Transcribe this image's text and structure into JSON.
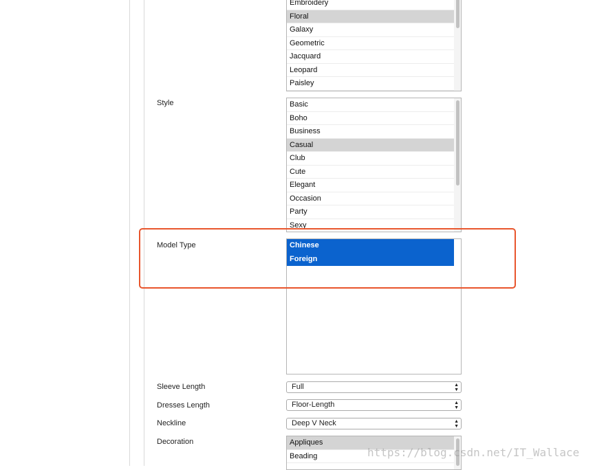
{
  "pattern": {
    "items": [
      "Embroidery",
      "Floral",
      "Galaxy",
      "Geometric",
      "Jacquard",
      "Leopard",
      "Paisley"
    ]
  },
  "style": {
    "label": "Style",
    "items": [
      "Basic",
      "Boho",
      "Business",
      "Casual",
      "Club",
      "Cute",
      "Elegant",
      "Occasion",
      "Party",
      "Sexy"
    ]
  },
  "model_type": {
    "label": "Model Type",
    "items": [
      "Chinese",
      "Foreign"
    ]
  },
  "sleeve_length": {
    "label": "Sleeve Length",
    "value": "Full"
  },
  "dresses_length": {
    "label": "Dresses Length",
    "value": "Floor-Length"
  },
  "neckline": {
    "label": "Neckline",
    "value": "Deep V Neck"
  },
  "decoration": {
    "label": "Decoration",
    "items": [
      "Appliques",
      "Beading"
    ]
  },
  "watermark": "https://blog.csdn.net/IT_Wallace",
  "colors": {
    "highlight": "#e8542b",
    "selection": "#0b63ce"
  }
}
